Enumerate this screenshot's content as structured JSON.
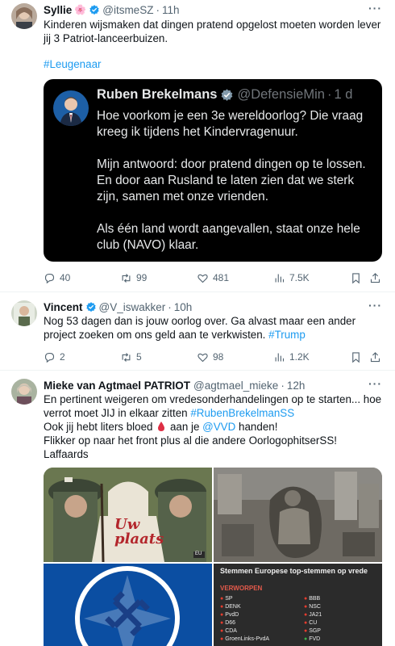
{
  "tweets": [
    {
      "name": "Syllie",
      "name_emoji": "🌸",
      "handle": "@itsmeSZ",
      "time": "11h",
      "text": "Kinderen wijsmaken dat dingen pratend opgelost moeten worden lever jij 3 Patriot-lanceerbuizen.",
      "hashtag": "#Leugenaar",
      "quote": {
        "name": "Ruben Brekelmans",
        "handle": "@DefensieMin",
        "time": "1 d",
        "paragraphs": [
          "Hoe voorkom je een 3e wereldoorlog? Die vraag kreeg ik tijdens het Kindervragenuur.",
          "Mijn antwoord: door pratend dingen op te lossen. En door aan Rusland te laten zien dat we sterk zijn, samen met onze vrienden.",
          "Als één land wordt aangevallen, staat onze hele club (NAVO) klaar."
        ]
      },
      "replies": "40",
      "reposts": "99",
      "likes": "481",
      "views": "7.5K"
    },
    {
      "name": "Vincent",
      "handle": "@V_iswakker",
      "time": "10h",
      "text": "Nog 53 dagen dan is jouw oorlog over. Ga alvast maar een ander project zoeken om ons geld aan te verkwisten.",
      "hashtag": "#Trump",
      "replies": "2",
      "reposts": "5",
      "likes": "98",
      "views": "1.2K"
    },
    {
      "name": "Mieke van Agtmael PATRIOT",
      "handle": "@agtmael_mieke",
      "time": "12h",
      "line1": "En pertinent weigeren om vredesonderhandelingen op te starten... hoe verrot moet JIJ in elkaar zitten",
      "hashtag": "#RubenBrekelmanSS",
      "line2_a": "Ook jij hebt liters bloed",
      "line2_b": "aan je",
      "mention": "@VVD",
      "line2_c": "handen!",
      "line3": "Flikker op naar het front plus al die andere OorlogophitserSS!",
      "line4": "Laffaards",
      "media": {
        "poster_text": "Uw plaats",
        "poster_badge": "EU",
        "card_title": "Stemmen Europese top-stemmen op vrede",
        "card_subtitle": "VERWORPEN",
        "parties_left": [
          "SP",
          "DENK",
          "PvdD",
          "D66",
          "CDA",
          "GroenLinks-PvdA"
        ],
        "parties_right": [
          "BBB",
          "NSC",
          "JA21",
          "CU",
          "SGP",
          "FVD"
        ]
      }
    }
  ],
  "colors": {
    "link": "#1d9bf0",
    "muted": "#536471",
    "verified": "#1d9bf0"
  }
}
